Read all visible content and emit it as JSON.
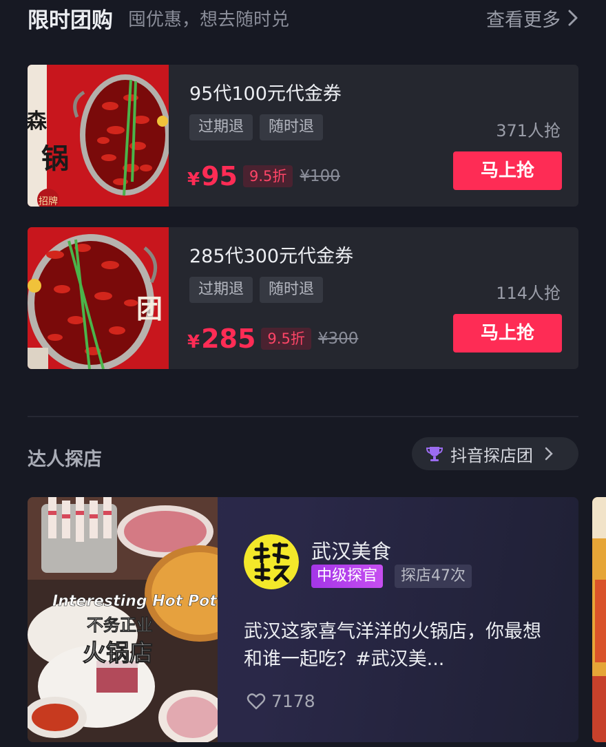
{
  "flash_deals": {
    "title": "限时团购",
    "subtitle": "囤优惠，想去随时兑",
    "more_label": "查看更多",
    "deals": [
      {
        "title": "95代100元代金券",
        "tags": [
          "过期退",
          "随时退"
        ],
        "grab_count": "371人抢",
        "currency": "¥",
        "price": "95",
        "discount": "9.5折",
        "original_price": "¥100",
        "button": "马上抢",
        "thumb_text": "招牌"
      },
      {
        "title": "285代300元代金券",
        "tags": [
          "过期退",
          "随时退"
        ],
        "grab_count": "114人抢",
        "currency": "¥",
        "price": "285",
        "discount": "9.5折",
        "original_price": "¥300",
        "button": "马上抢",
        "thumb_text": "团"
      }
    ]
  },
  "influencers": {
    "title": "达人探店",
    "team_pill": "抖音探店团",
    "post": {
      "author": "武汉美食",
      "level": "中级探官",
      "visits": "探店47次",
      "text": "武汉这家喜气洋洋的火锅店，你最想和谁一起吃？#武汉美...",
      "likes": "7178",
      "thumb_caption_1": "Interesting Hot Pot",
      "thumb_caption_2": "不务正业",
      "thumb_caption_3": "火锅店"
    }
  },
  "colors": {
    "background": "#171923",
    "card": "#25272f",
    "accent": "#fe2c55",
    "level_badge": "#b040ec"
  },
  "icons": {
    "more": "chevron-right-icon",
    "team": "trophy-icon",
    "likes": "heart-icon"
  }
}
